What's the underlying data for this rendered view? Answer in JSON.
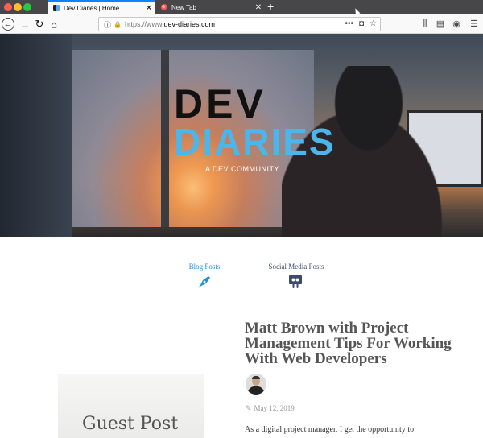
{
  "browser": {
    "tabs": [
      {
        "title": "Dev Diaries | Home",
        "active": true
      },
      {
        "title": "New Tab",
        "active": false
      }
    ],
    "new_tab_label": "+",
    "url_prefix": "https://www.",
    "url_domain": "dev-diaries.com",
    "page_actions": "•••"
  },
  "hero": {
    "logo_top": "DEV",
    "logo_bottom": "DIARIES",
    "tagline": "A DEV COMMUNITY"
  },
  "categories": [
    {
      "label": "Blog Posts",
      "icon": "pen-nib-icon"
    },
    {
      "label": "Social Media Posts",
      "icon": "slideshare-icon"
    }
  ],
  "post": {
    "title": "Matt Brown with Project Management Tips For Working With Web Developers",
    "date": "May 12, 2019",
    "excerpt": "As a digital project manager, I get the opportunity to",
    "thumbnail_text": "Guest Post"
  },
  "colors": {
    "accent": "#1a8fd8",
    "logo_blue": "#4cb5ea"
  }
}
